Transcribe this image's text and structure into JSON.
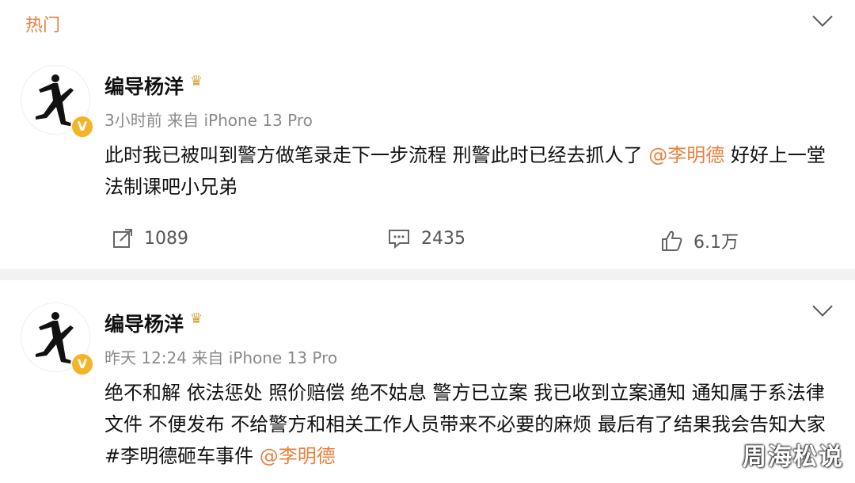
{
  "header": {
    "tab_label": "热门"
  },
  "posts": [
    {
      "author": "编导杨洋",
      "time": "3小时前",
      "source": "来自 iPhone 13 Pro",
      "text_main": "此时我已被叫到警方做笔录走下一步流程 刑警此时已经去抓人了 ",
      "mention": "@李明德",
      "text_tail": " 好好上一堂法制课吧小兄弟",
      "repost_count": "1089",
      "comment_count": "2435",
      "like_count": "6.1万"
    },
    {
      "author": "编导杨洋",
      "time": "昨天 12:24",
      "source": "来自 iPhone 13 Pro",
      "text_main": "绝不和解 依法惩处 照价赔偿 绝不姑息 警方已立案 我已收到立案通知 通知属于系法律文件 不便发布 不给警方和相关工作人员带来不必要的麻烦 最后有了结果我会告知大家 ",
      "hashtag": "#李明德砸车事件",
      "mention": "@李明德"
    }
  ],
  "watermark": "周海松说",
  "colors": {
    "accent": "#e8803f",
    "verified": "#f4b428"
  },
  "icons": {
    "dropdown": "chevron-down-icon",
    "repost": "repost-icon",
    "comment": "comment-icon",
    "like": "like-icon"
  }
}
